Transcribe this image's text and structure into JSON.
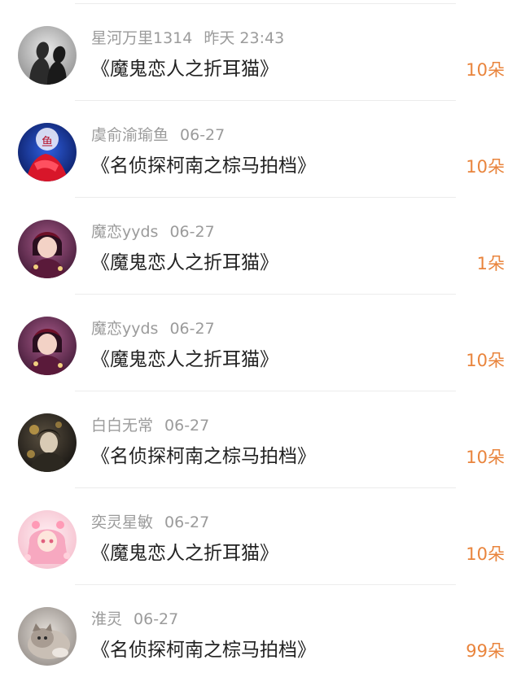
{
  "rows": [
    {
      "user": "星河万里1314",
      "date": "昨天 23:43",
      "title": "《魔鬼恋人之折耳猫》",
      "count": "10朵",
      "avatar": "silhouette-couple"
    },
    {
      "user": "虞俞渝瑜鱼",
      "date": "06-27",
      "title": "《名侦探柯南之棕马拍档》",
      "count": "10朵",
      "avatar": "red-blue-art"
    },
    {
      "user": "魔恋yyds",
      "date": "06-27",
      "title": "《魔鬼恋人之折耳猫》",
      "count": "1朵",
      "avatar": "anime-character-purple"
    },
    {
      "user": "魔恋yyds",
      "date": "06-27",
      "title": "《魔鬼恋人之折耳猫》",
      "count": "10朵",
      "avatar": "anime-character-purple"
    },
    {
      "user": "白白无常",
      "date": "06-27",
      "title": "《名侦探柯南之棕马拍档》",
      "count": "10朵",
      "avatar": "dark-gold-art"
    },
    {
      "user": "奕灵星敏",
      "date": "06-27",
      "title": "《魔鬼恋人之折耳猫》",
      "count": "10朵",
      "avatar": "pink-anime-girl"
    },
    {
      "user": "淮灵",
      "date": "06-27",
      "title": "《名侦探柯南之棕马拍档》",
      "count": "99朵",
      "avatar": "cat-photo"
    }
  ],
  "colors": {
    "count": "#e9843c",
    "username": "#9b9b9b",
    "title": "#222222"
  }
}
